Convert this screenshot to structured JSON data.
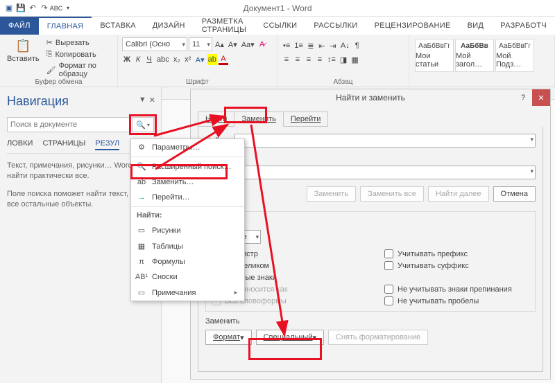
{
  "window": {
    "title": "Документ1 - Word"
  },
  "tabs": {
    "file": "ФАЙЛ",
    "home": "ГЛАВНАЯ",
    "insert": "ВСТАВКА",
    "design": "ДИЗАЙН",
    "layout": "РАЗМЕТКА СТРАНИЦЫ",
    "refs": "ССЫЛКИ",
    "mail": "РАССЫЛКИ",
    "review": "РЕЦЕНЗИРОВАНИЕ",
    "view": "ВИД",
    "dev": "РАЗРАБОТЧ"
  },
  "ribbon": {
    "clipboard": {
      "label": "Буфер обмена",
      "paste": "Вставить",
      "cut": "Вырезать",
      "copy": "Копировать",
      "fmtpaint": "Формат по образцу"
    },
    "font": {
      "label": "Шрифт",
      "family": "Calibri (Осно",
      "size": "11"
    },
    "para": {
      "label": "Абзац"
    },
    "styles": {
      "items": [
        "АаБбВвГг",
        "АаБбВв",
        "АаБбВвГг"
      ],
      "names": [
        "Мои статьи",
        "Мой загол…",
        "Мой Подз…"
      ]
    }
  },
  "nav": {
    "title": "Навигация",
    "placeholder": "Поиск в документе",
    "tabs": {
      "head": "ЛОВКИ",
      "pages": "СТРАНИЦЫ",
      "results": "РЕЗУЛ"
    },
    "p1": "Текст, примечания, рисунки… Word найти практически все.",
    "p2": "Поле поиска поможет найти текст, а — все остальные объекты."
  },
  "dropdown": {
    "options": "Параметры…",
    "advfind": "Расширенный поиск…",
    "replace": "Заменить…",
    "goto": "Перейти…",
    "findhdr": "Найти:",
    "pics": "Рисунки",
    "tables": "Таблицы",
    "formulas": "Формулы",
    "footnotes": "Сноски",
    "comments": "Примечания"
  },
  "dialog": {
    "title": "Найти и заменить",
    "help": "?",
    "tabs": {
      "find": "Найти",
      "replace": "Заменить",
      "goto": "Перейти"
    },
    "lblFind": "Найти:",
    "btnReplace": "Заменить",
    "btnReplaceAll": "Заменить все",
    "btnFindNext": "Найти далее",
    "btnCancel": "Отмена",
    "searchParams": {
      "title": "иска",
      "dirLabel": "е:",
      "dirValue": "Везде"
    },
    "chk": {
      "case": "ь регистр",
      "whole": "ово целиком",
      "wild": "овочные знаки",
      "sounds": "Произносится как",
      "forms": "Все словоформы",
      "prefix": "Учитывать префикс",
      "suffix": "Учитывать суффикс",
      "punct": "Не учитывать знаки препинания",
      "space": "Не учитывать пробелы"
    },
    "bottom": {
      "label": "Заменить",
      "format": "Формат",
      "special": "Специальный",
      "clear": "Снять форматирование"
    }
  }
}
